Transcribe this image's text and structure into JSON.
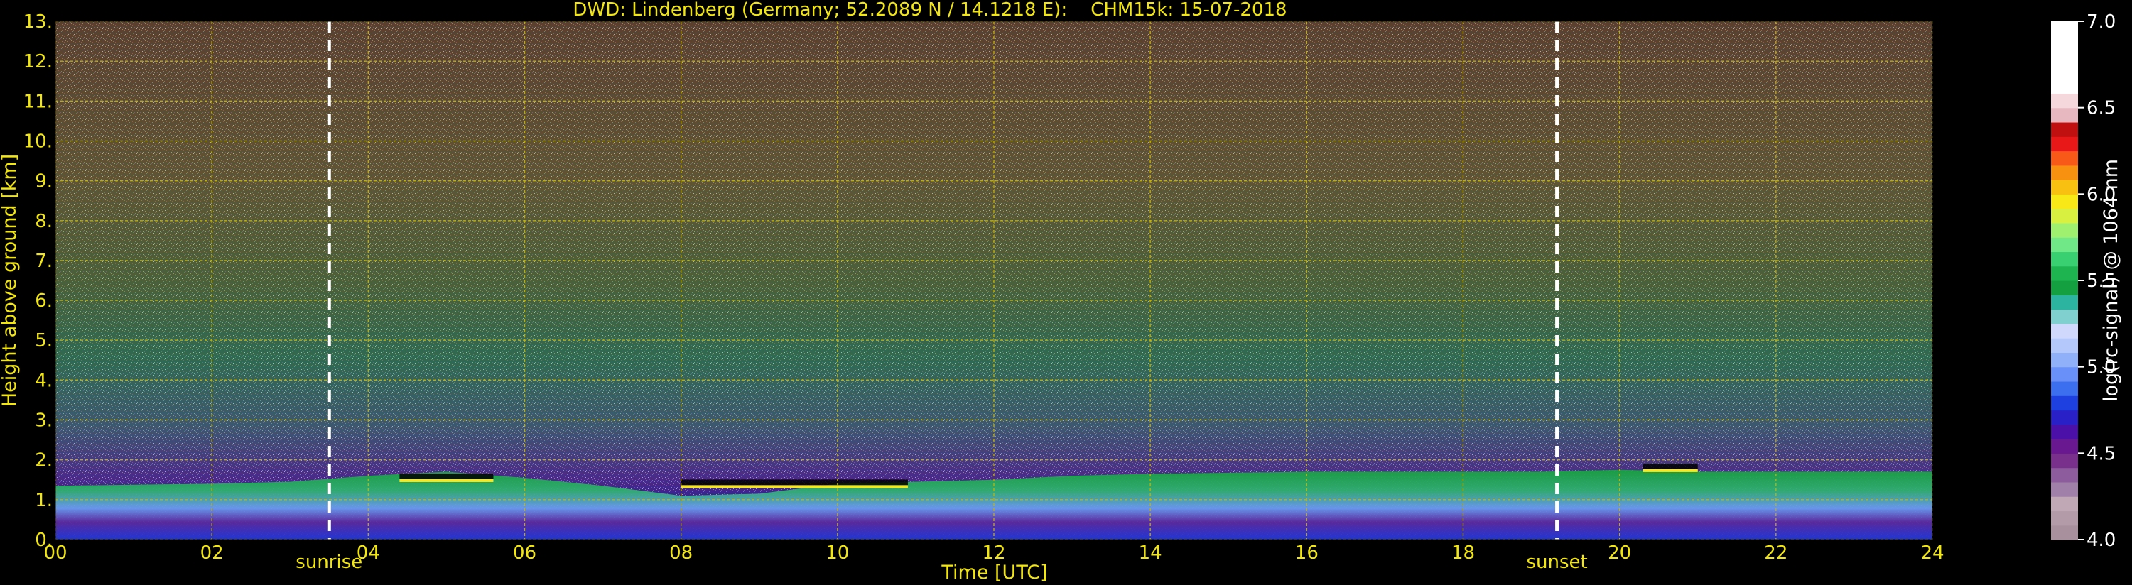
{
  "colors": {
    "background": "#000000",
    "text_yellow": "#f2e60a",
    "grid": "#c8b400",
    "event_line": "#ffffff",
    "colorbar": [
      "#a8909c",
      "#b39ca8",
      "#c0a8b4",
      "#a080a8",
      "#8c5c9c",
      "#78308c",
      "#6a1890",
      "#4a10a8",
      "#2a20c8",
      "#1e40e0",
      "#3c6ef0",
      "#6890f8",
      "#90b0fa",
      "#b4c8fc",
      "#d0d8fc",
      "#80d0d0",
      "#2cb4a0",
      "#14a040",
      "#1eb450",
      "#38d070",
      "#70e888",
      "#a0f070",
      "#d8f040",
      "#f8e818",
      "#f8c010",
      "#f89010",
      "#f85818",
      "#e81818",
      "#c01010",
      "#e8b8c0",
      "#f4d8dc",
      "#ffffff",
      "#ffffff",
      "#ffffff",
      "#ffffff",
      "#ffffff"
    ]
  },
  "chart_data": {
    "type": "heatmap",
    "title": "DWD: Lindenberg (Germany; 52.2089 N / 14.1218 E):    CHM15k: 15-07-2018",
    "xlabel": "Time [UTC]",
    "ylabel": "Height above ground [km]",
    "colorbar_label": "log(rc-signal) @ 1064 nm",
    "xlim": [
      0,
      24
    ],
    "ylim": [
      0,
      13
    ],
    "x_ticks": [
      0,
      2,
      4,
      6,
      8,
      10,
      12,
      14,
      16,
      18,
      20,
      22,
      24
    ],
    "x_tick_labels": [
      "00",
      "02",
      "04",
      "06",
      "08",
      "10",
      "12",
      "14",
      "16",
      "18",
      "20",
      "22",
      "24"
    ],
    "y_ticks": [
      0,
      1,
      2,
      3,
      4,
      5,
      6,
      7,
      8,
      9,
      10,
      11,
      12,
      13
    ],
    "y_tick_labels": [
      "0.",
      "1.",
      "2.",
      "3.",
      "4.",
      "5.",
      "6.",
      "7.",
      "8.",
      "9.",
      "10.",
      "11.",
      "12.",
      "13."
    ],
    "colorbar_range": [
      4.0,
      7.0
    ],
    "colorbar_ticks": [
      4.0,
      4.5,
      5.0,
      5.5,
      6.0,
      6.5,
      7.0
    ],
    "colorbar_tick_labels": [
      "4.0",
      "4.5",
      "5.0",
      "5.5",
      "6.0",
      "6.5",
      "7.0"
    ],
    "grid": true,
    "events": [
      {
        "label": "sunrise",
        "time": 3.5
      },
      {
        "label": "sunset",
        "time": 19.2
      }
    ],
    "boundary_layer_top_km": [
      [
        0,
        1.35
      ],
      [
        2,
        1.4
      ],
      [
        3,
        1.45
      ],
      [
        4,
        1.6
      ],
      [
        5,
        1.7
      ],
      [
        6,
        1.55
      ],
      [
        7,
        1.35
      ],
      [
        8,
        1.1
      ],
      [
        9,
        1.15
      ],
      [
        10,
        1.4
      ],
      [
        11,
        1.45
      ],
      [
        12,
        1.5
      ],
      [
        13,
        1.6
      ],
      [
        14,
        1.65
      ],
      [
        16,
        1.7
      ],
      [
        18,
        1.7
      ],
      [
        19,
        1.7
      ],
      [
        20,
        1.75
      ],
      [
        21,
        1.7
      ],
      [
        22,
        1.7
      ],
      [
        24,
        1.7
      ]
    ],
    "cloud_features": [
      {
        "time_start": 4.4,
        "time_end": 5.6,
        "height_km": 1.55
      },
      {
        "time_start": 8.0,
        "time_end": 10.9,
        "height_km": 1.4
      },
      {
        "time_start": 20.3,
        "time_end": 21.0,
        "height_km": 1.8
      }
    ]
  }
}
